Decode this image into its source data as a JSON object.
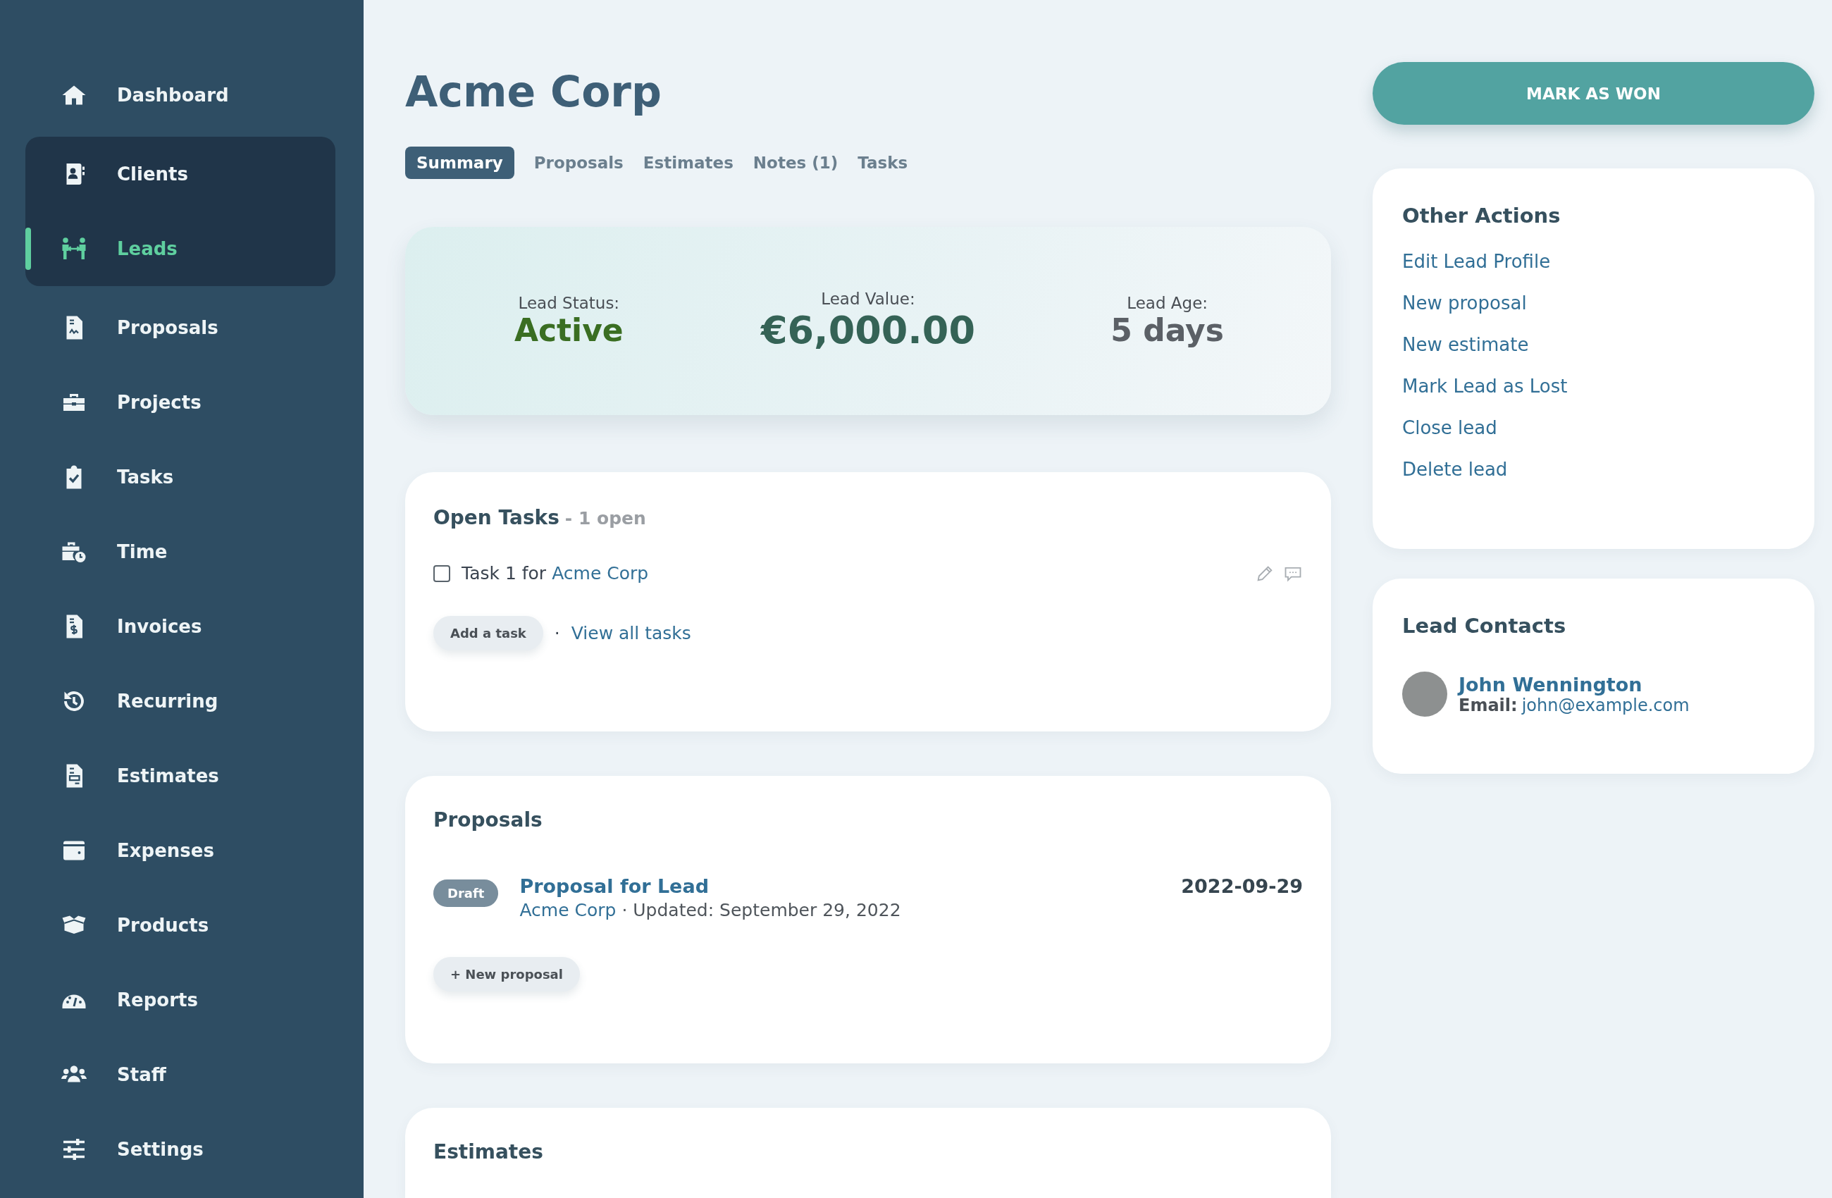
{
  "sidebar": {
    "items": [
      {
        "label": "Dashboard",
        "selected": false
      },
      {
        "label": "Clients",
        "selected": false,
        "expanded": true,
        "children": [
          {
            "label": "Leads",
            "selected": true
          }
        ]
      },
      {
        "label": "Proposals",
        "selected": false
      },
      {
        "label": "Projects",
        "selected": false
      },
      {
        "label": "Tasks",
        "selected": false
      },
      {
        "label": "Time",
        "selected": false
      },
      {
        "label": "Invoices",
        "selected": false
      },
      {
        "label": "Recurring",
        "selected": false
      },
      {
        "label": "Estimates",
        "selected": false
      },
      {
        "label": "Expenses",
        "selected": false
      },
      {
        "label": "Products",
        "selected": false
      },
      {
        "label": "Reports",
        "selected": false
      },
      {
        "label": "Staff",
        "selected": false
      },
      {
        "label": "Settings",
        "selected": false
      }
    ]
  },
  "page": {
    "title": "Acme Corp"
  },
  "tabs": [
    {
      "label": "Summary",
      "selected": true
    },
    {
      "label": "Proposals",
      "selected": false
    },
    {
      "label": "Estimates",
      "selected": false
    },
    {
      "label": "Notes (1)",
      "selected": false
    },
    {
      "label": "Tasks",
      "selected": false
    }
  ],
  "summary": [
    {
      "kind": "status",
      "label": "Lead Status:",
      "value": "Active"
    },
    {
      "kind": "money",
      "label": "Lead Value:",
      "value": "€6,000.00"
    },
    {
      "kind": "age",
      "label": "Lead Age:",
      "value": "5 days"
    }
  ],
  "open_tasks": {
    "title": "Open Tasks",
    "count": "- 1 open",
    "tasks": [
      {
        "text": "Task 1 for",
        "link": "Acme Corp",
        "checked": false
      }
    ],
    "add_button": "Add a task",
    "separator": "·",
    "view_all": "View all tasks"
  },
  "proposals": {
    "title": "Proposals",
    "items": [
      {
        "status": "Draft",
        "title": "Proposal for Lead",
        "client": "Acme Corp",
        "updated": "· Updated: September 29, 2022",
        "date": "2022-09-29"
      }
    ],
    "new_button": "+ New proposal"
  },
  "estimates": {
    "title": "Estimates"
  },
  "mark_won_button": "MARK AS WON",
  "other_actions": {
    "title": "Other Actions",
    "links": [
      "Edit Lead Profile",
      "New proposal",
      "New estimate",
      "Mark Lead as Lost",
      "Close lead",
      "Delete lead"
    ]
  },
  "lead_contacts": {
    "title": "Lead Contacts",
    "contacts": [
      {
        "name": "John Wennington",
        "email_label": "Email:",
        "email": "john@example.com"
      }
    ]
  }
}
